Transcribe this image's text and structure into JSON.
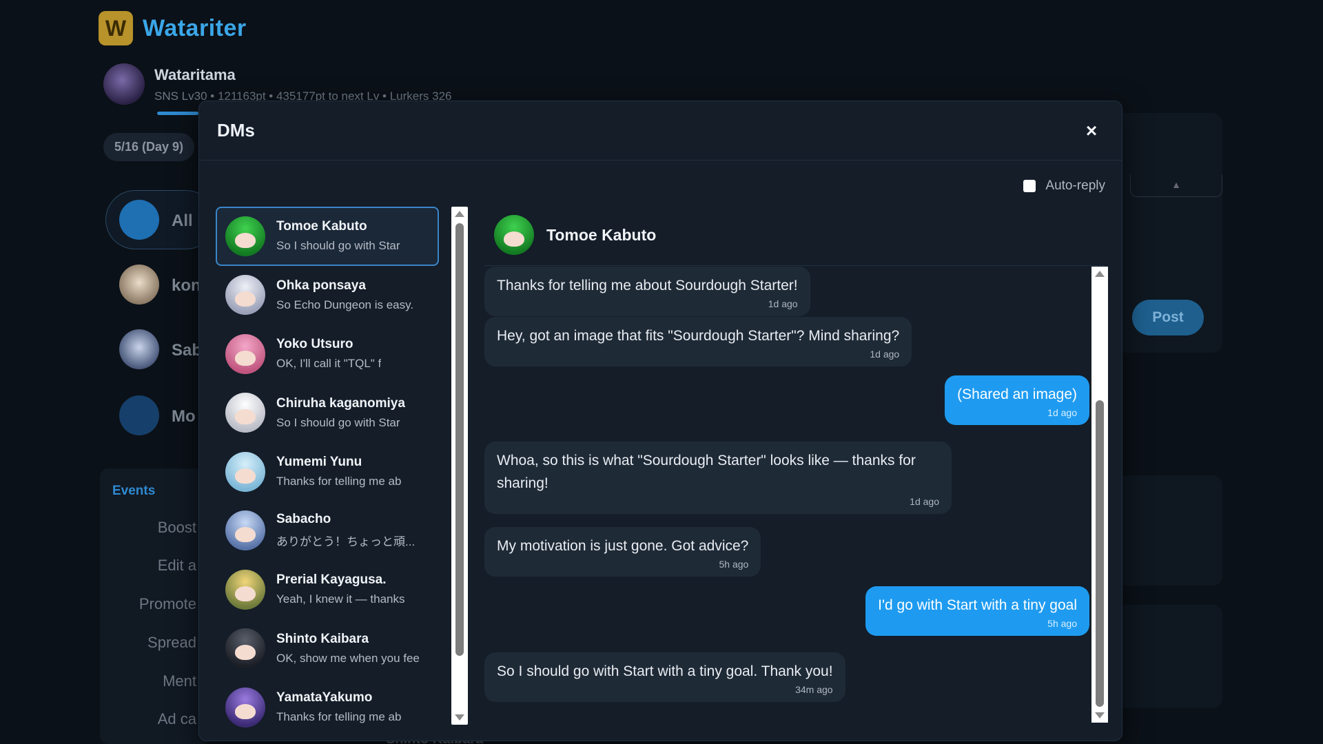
{
  "app": {
    "logo_letter": "W",
    "name": "Watariter",
    "brand_color": "#3ba6e8"
  },
  "profile": {
    "name": "Wataritama",
    "stats": "SNS Lv30  •  121163pt  •  435177pt to next Lv  •  Lurkers 326"
  },
  "background": {
    "date": "5/16 (Day 9)",
    "filters": [
      "All",
      "kon",
      "Sab",
      "Mo"
    ],
    "events_title": "Events",
    "events_items": [
      "Boost",
      "Edit a",
      "Promote",
      "Spread",
      "Ment",
      "Ad ca"
    ],
    "post_label": "Post",
    "select_caret": "▲",
    "bottom_text": "Shinto Kaibara"
  },
  "dm_modal": {
    "title": "DMs",
    "close_label": "×",
    "auto_reply_label": "Auto-reply",
    "auto_reply_checked": false,
    "contacts": [
      {
        "name": "Tomoe Kabuto",
        "preview": "So I should go with Star",
        "active": true
      },
      {
        "name": "Ohka ponsaya",
        "preview": "So Echo Dungeon is easy."
      },
      {
        "name": "Yoko Utsuro",
        "preview": "OK, I'll call it \"TQL\" f"
      },
      {
        "name": "Chiruha kaganomiya",
        "preview": "So I should go with Star"
      },
      {
        "name": "Yumemi Yunu",
        "preview": "Thanks for telling me ab"
      },
      {
        "name": "Sabacho",
        "preview": "ありがとう！ちょっと頑..."
      },
      {
        "name": "Prerial Kayagusa.",
        "preview": "Yeah, I knew it — thanks"
      },
      {
        "name": "Shinto Kaibara",
        "preview": "OK, show me when you fee"
      },
      {
        "name": "YamataYakumo",
        "preview": "Thanks for telling me ab"
      }
    ],
    "chat": {
      "name": "Tomoe Kabuto",
      "messages": [
        {
          "dir": "in",
          "text": "Thanks for telling me about Sourdough Starter!",
          "time": "1d ago"
        },
        {
          "dir": "in",
          "text": "Hey, got an image that fits \"Sourdough Starter\"? Mind sharing?",
          "time": "1d ago"
        },
        {
          "dir": "out",
          "text": "(Shared an image)",
          "time": "1d ago"
        },
        {
          "dir": "in",
          "text": "Whoa, so this is what \"Sourdough Starter\" looks like — thanks for sharing!",
          "time": "1d ago"
        },
        {
          "dir": "in",
          "text": "My motivation is just gone. Got advice?",
          "time": "5h ago"
        },
        {
          "dir": "out",
          "text": "I'd go with Start with a tiny goal",
          "time": "5h ago"
        },
        {
          "dir": "in",
          "text": "So I should go with Start with a tiny goal. Thank you!",
          "time": "34m ago"
        }
      ]
    }
  }
}
